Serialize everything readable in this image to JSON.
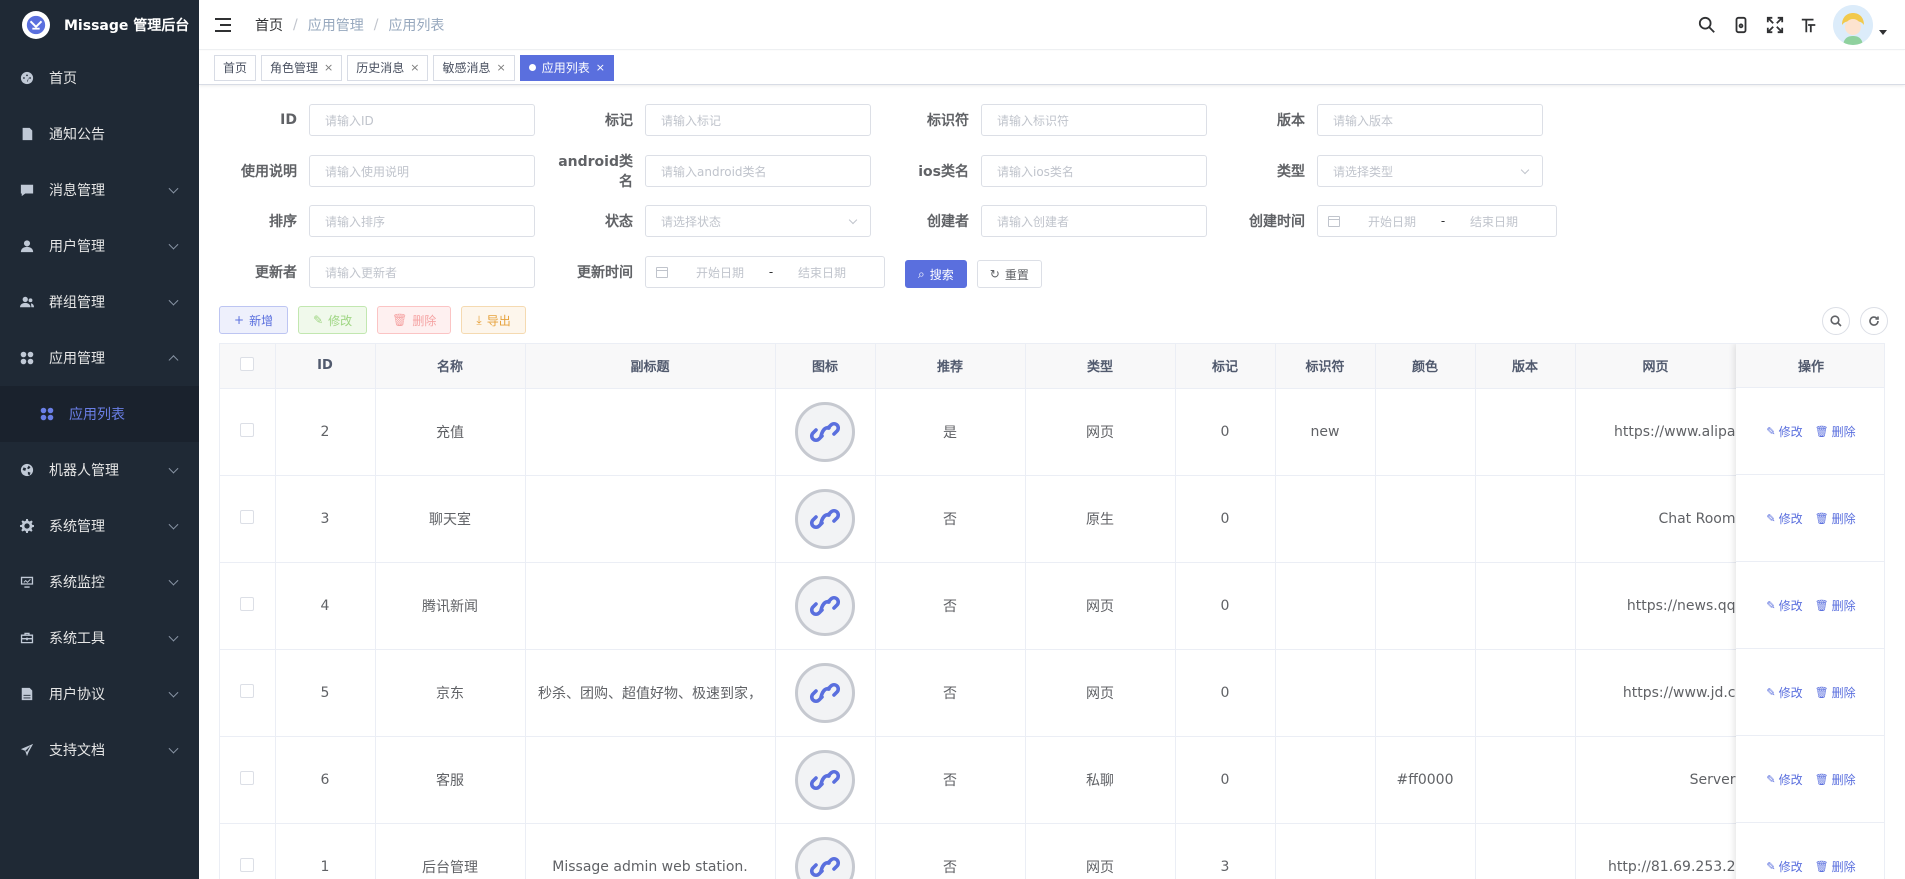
{
  "app": {
    "title": "Missage 管理后台"
  },
  "sidebar": {
    "items": [
      {
        "label": "首页",
        "icon": "dashboard-icon",
        "has_children": false
      },
      {
        "label": "通知公告",
        "icon": "notice-icon",
        "has_children": false
      },
      {
        "label": "消息管理",
        "icon": "message-icon",
        "has_children": true
      },
      {
        "label": "用户管理",
        "icon": "user-icon",
        "has_children": true
      },
      {
        "label": "群组管理",
        "icon": "group-icon",
        "has_children": true
      },
      {
        "label": "应用管理",
        "icon": "apps-icon",
        "has_children": true,
        "expanded": true
      },
      {
        "label": "机器人管理",
        "icon": "robot-icon",
        "has_children": true
      },
      {
        "label": "系统管理",
        "icon": "gear-icon",
        "has_children": true
      },
      {
        "label": "系统监控",
        "icon": "monitor-icon",
        "has_children": true
      },
      {
        "label": "系统工具",
        "icon": "toolbox-icon",
        "has_children": true
      },
      {
        "label": "用户协议",
        "icon": "document-icon",
        "has_children": true
      },
      {
        "label": "支持文档",
        "icon": "send-icon",
        "has_children": true
      }
    ],
    "sub_active": "应用列表"
  },
  "breadcrumb": {
    "home": "首页",
    "sep": "/",
    "level1": "应用管理",
    "level2": "应用列表"
  },
  "tags": [
    {
      "label": "首页",
      "closable": false
    },
    {
      "label": "角色管理",
      "closable": true
    },
    {
      "label": "历史消息",
      "closable": true
    },
    {
      "label": "敏感消息",
      "closable": true
    },
    {
      "label": "应用列表",
      "closable": true,
      "active": true
    }
  ],
  "tag_close": "×",
  "form": {
    "id_label": "ID",
    "id_ph": "请输入ID",
    "mark_label": "标记",
    "mark_ph": "请输入标记",
    "ident_label": "标识符",
    "ident_ph": "请输入标识符",
    "version_label": "版本",
    "version_ph": "请输入版本",
    "usage_label": "使用说明",
    "usage_ph": "请输入使用说明",
    "android_label": "android类名",
    "android_ph": "请输入android类名",
    "ios_label": "ios类名",
    "ios_ph": "请输入ios类名",
    "type_label": "类型",
    "type_ph": "请选择类型",
    "sort_label": "排序",
    "sort_ph": "请输入排序",
    "status_label": "状态",
    "status_ph": "请选择状态",
    "creator_label": "创建者",
    "creator_ph": "请输入创建者",
    "ctime_label": "创建时间",
    "date_start": "开始日期",
    "date_sep": "-",
    "date_end": "结束日期",
    "updater_label": "更新者",
    "updater_ph": "请输入更新者",
    "utime_label": "更新时间",
    "search_btn": "搜索",
    "reset_btn": "重置"
  },
  "toolbar": {
    "add": "新增",
    "edit": "修改",
    "delete": "删除",
    "export": "导出"
  },
  "table": {
    "headers": {
      "id": "ID",
      "name": "名称",
      "subtitle": "副标题",
      "icon": "图标",
      "recommend": "推荐",
      "type": "类型",
      "mark": "标记",
      "ident": "标识符",
      "color": "颜色",
      "version": "版本",
      "web": "网页",
      "ops": "操作"
    },
    "rows": [
      {
        "id": "2",
        "name": "充值",
        "subtitle": "",
        "recommend": "是",
        "type": "网页",
        "mark": "0",
        "ident": "new",
        "color": "",
        "version": "",
        "web": "https://www.alipa"
      },
      {
        "id": "3",
        "name": "聊天室",
        "subtitle": "",
        "recommend": "否",
        "type": "原生",
        "mark": "0",
        "ident": "",
        "color": "",
        "version": "",
        "web": "Chat Room"
      },
      {
        "id": "4",
        "name": "腾讯新闻",
        "subtitle": "",
        "recommend": "否",
        "type": "网页",
        "mark": "0",
        "ident": "",
        "color": "",
        "version": "",
        "web": "https://news.qq"
      },
      {
        "id": "5",
        "name": "京东",
        "subtitle": "秒杀、团购、超值好物、极速到家，",
        "recommend": "否",
        "type": "网页",
        "mark": "0",
        "ident": "",
        "color": "",
        "version": "",
        "web": "https://www.jd.c"
      },
      {
        "id": "6",
        "name": "客服",
        "subtitle": "",
        "recommend": "否",
        "type": "私聊",
        "mark": "0",
        "ident": "",
        "color": "#ff0000",
        "version": "",
        "web": "Server"
      },
      {
        "id": "1",
        "name": "后台管理",
        "subtitle": "Missage admin web station.",
        "recommend": "否",
        "type": "网页",
        "mark": "3",
        "ident": "",
        "color": "",
        "version": "",
        "web": "http://81.69.253.2"
      }
    ],
    "op_edit": "修改",
    "op_delete": "删除"
  },
  "colors": {
    "primary": "#5a6fde",
    "sidebar_bg": "#1f2935"
  }
}
